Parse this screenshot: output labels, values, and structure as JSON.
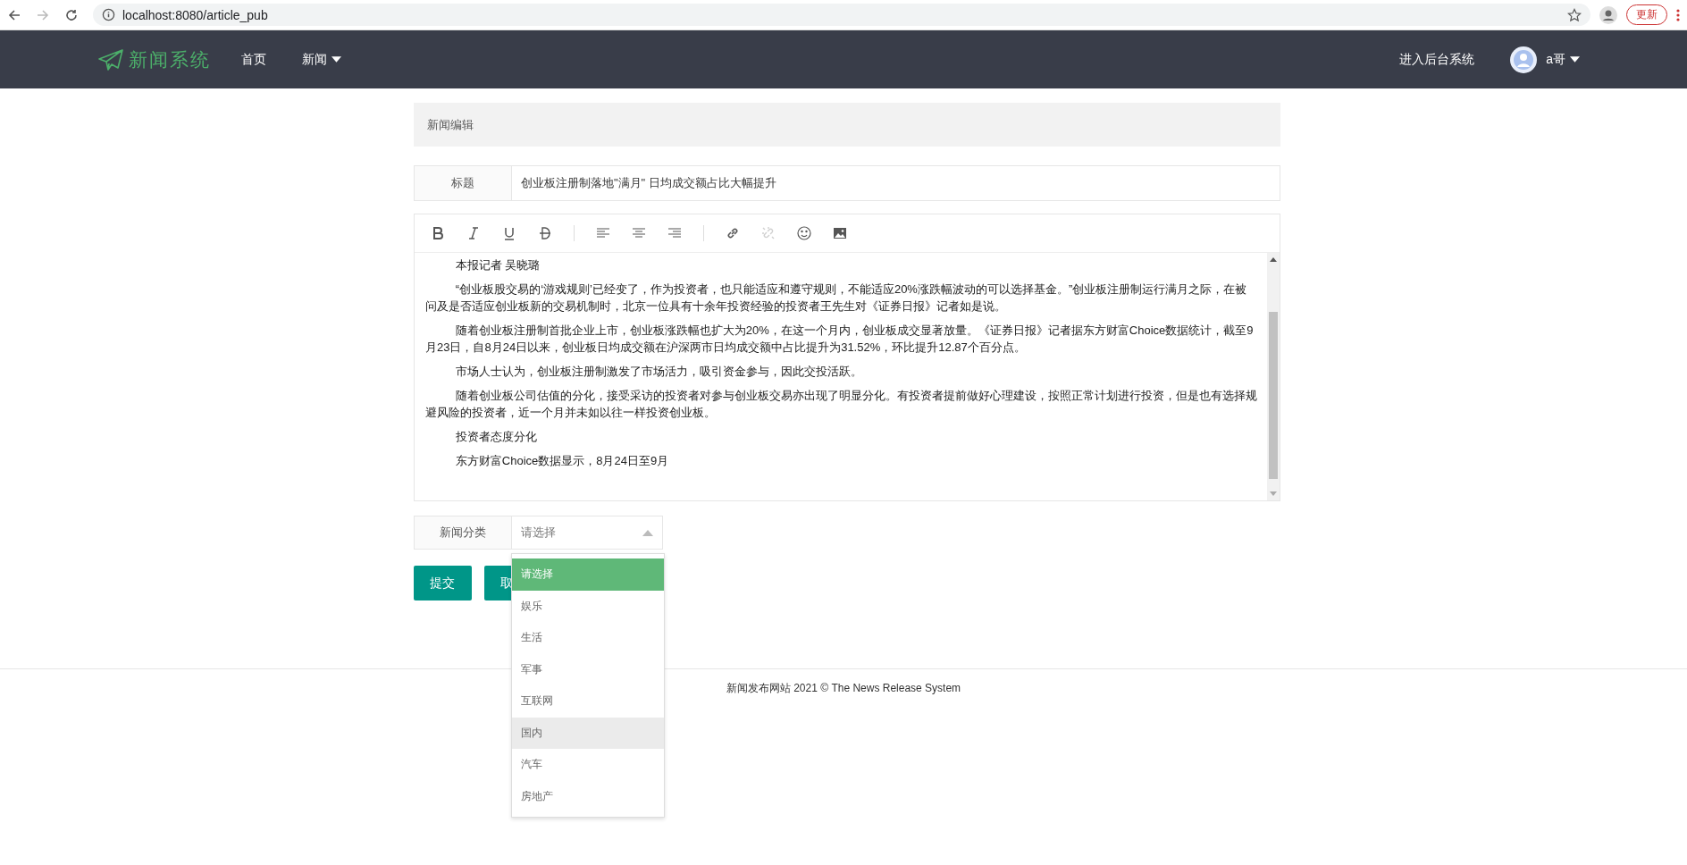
{
  "browser": {
    "url": "localhost:8080/article_pub",
    "update_button": "更新",
    "forward_disabled": true
  },
  "navbar": {
    "logo": "新闻系统",
    "links": [
      {
        "label": "首页",
        "has_menu": false
      },
      {
        "label": "新闻",
        "has_menu": true
      }
    ],
    "admin_link": "进入后台系统",
    "user": "a哥"
  },
  "panel_title": "新闻编辑",
  "title_field": {
    "label": "标题",
    "value": "创业板注册制落地\"满月\" 日均成交额占比大幅提升"
  },
  "toolbar": [
    {
      "kind": "bold",
      "disabled": false
    },
    {
      "kind": "italic",
      "disabled": false
    },
    {
      "kind": "underline",
      "disabled": false
    },
    {
      "kind": "strike",
      "disabled": false
    },
    {
      "kind": "sep"
    },
    {
      "kind": "left",
      "disabled": false
    },
    {
      "kind": "center",
      "disabled": false
    },
    {
      "kind": "right",
      "disabled": false
    },
    {
      "kind": "sep"
    },
    {
      "kind": "link",
      "disabled": false
    },
    {
      "kind": "unlink",
      "disabled": true
    },
    {
      "kind": "emoji",
      "disabled": false
    },
    {
      "kind": "image",
      "disabled": false
    }
  ],
  "editor_paragraphs": [
    "本报记者 吴晓璐",
    "“创业板股交易的‘游戏规则’已经变了，作为投资者，也只能适应和遵守规则，不能适应20%涨跌幅波动的可以选择基金。”创业板注册制运行满月之际，在被问及是否适应创业板新的交易机制时，北京一位具有十余年投资经验的投资者王先生对《证券日报》记者如是说。",
    "随着创业板注册制首批企业上市，创业板涨跌幅也扩大为20%，在这一个月内，创业板成交显著放量。《证券日报》记者据东方财富Choice数据统计，截至9月23日，自8月24日以来，创业板日均成交额在沪深两市日均成交额中占比提升为31.52%，环比提升12.87个百分点。",
    "市场人士认为，创业板注册制激发了市场活力，吸引资金参与，因此交投活跃。",
    "随着创业板公司估值的分化，接受采访的投资者对参与创业板交易亦出现了明显分化。有投资者提前做好心理建设，按照正常计划进行投资，但是也有选择规避风险的投资者，近一个月并未如以往一样投资创业板。",
    "投资者态度分化",
    "东方财富Choice数据显示，8月24日至9月"
  ],
  "category": {
    "label": "新闻分类",
    "placeholder": "请选择",
    "expanded": true,
    "options": [
      {
        "label": "请选择",
        "selected": true,
        "hovered": false
      },
      {
        "label": "娱乐",
        "selected": false,
        "hovered": false
      },
      {
        "label": "生活",
        "selected": false,
        "hovered": false
      },
      {
        "label": "军事",
        "selected": false,
        "hovered": false
      },
      {
        "label": "互联网",
        "selected": false,
        "hovered": false
      },
      {
        "label": "国内",
        "selected": false,
        "hovered": true
      },
      {
        "label": "汽车",
        "selected": false,
        "hovered": false
      },
      {
        "label": "房地产",
        "selected": false,
        "hovered": false
      }
    ]
  },
  "buttons": [
    "提交",
    "取"
  ],
  "footer": "新闻发布网站 2021 © The News Release System"
}
